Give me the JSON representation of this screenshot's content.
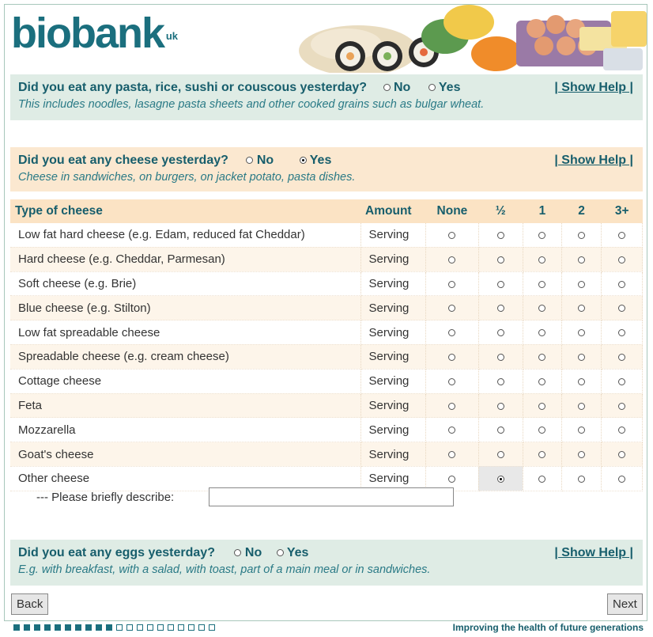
{
  "brand": {
    "name": "biobank",
    "suffix": "uk",
    "tagline": "Improving the health of future generations"
  },
  "questions": {
    "pasta": {
      "title": "Did you eat any pasta, rice, sushi or couscous yesterday?",
      "no": "No",
      "yes": "Yes",
      "selected": "none",
      "help": "| Show Help |",
      "hint": "This includes noodles, lasagne pasta sheets and other cooked grains such as bulgar wheat."
    },
    "cheese": {
      "title": "Did you eat any cheese yesterday?",
      "no": "No",
      "yes": "Yes",
      "selected": "yes",
      "help": "| Show Help |",
      "hint": "Cheese in sandwiches, on burgers, on jacket potato, pasta dishes."
    },
    "eggs": {
      "title": "Did you eat any eggs yesterday?",
      "no": "No",
      "yes": "Yes",
      "selected": "none",
      "help": "| Show Help |",
      "hint": "E.g. with breakfast, with a salad, with toast, part of a main meal or in sandwiches."
    }
  },
  "cheese_table": {
    "headers": {
      "type": "Type of cheese",
      "amount": "Amount",
      "none": "None",
      "half": "½",
      "one": "1",
      "two": "2",
      "three": "3+"
    },
    "rows": [
      {
        "label": "Low fat hard cheese (e.g. Edam, reduced fat Cheddar)",
        "amount": "Serving",
        "selected": null
      },
      {
        "label": "Hard cheese (e.g. Cheddar, Parmesan)",
        "amount": "Serving",
        "selected": null
      },
      {
        "label": "Soft cheese (e.g. Brie)",
        "amount": "Serving",
        "selected": null
      },
      {
        "label": "Blue cheese (e.g. Stilton)",
        "amount": "Serving",
        "selected": null
      },
      {
        "label": "Low fat spreadable cheese",
        "amount": "Serving",
        "selected": null
      },
      {
        "label": "Spreadable cheese (e.g. cream cheese)",
        "amount": "Serving",
        "selected": null
      },
      {
        "label": "Cottage cheese",
        "amount": "Serving",
        "selected": null
      },
      {
        "label": "Feta",
        "amount": "Serving",
        "selected": null
      },
      {
        "label": "Mozzarella",
        "amount": "Serving",
        "selected": null
      },
      {
        "label": "Goat's cheese",
        "amount": "Serving",
        "selected": null
      },
      {
        "label": "Other cheese",
        "amount": "Serving",
        "selected": "½"
      }
    ],
    "describe_label": "--- Please briefly describe:",
    "describe_value": ""
  },
  "nav": {
    "back": "Back",
    "next": "Next"
  },
  "progress": {
    "total": 20,
    "completed": 10
  },
  "colors": {
    "brand_teal": "#1b6f7e",
    "question_green": "#dfece5",
    "question_peach": "#fbe8d0"
  }
}
